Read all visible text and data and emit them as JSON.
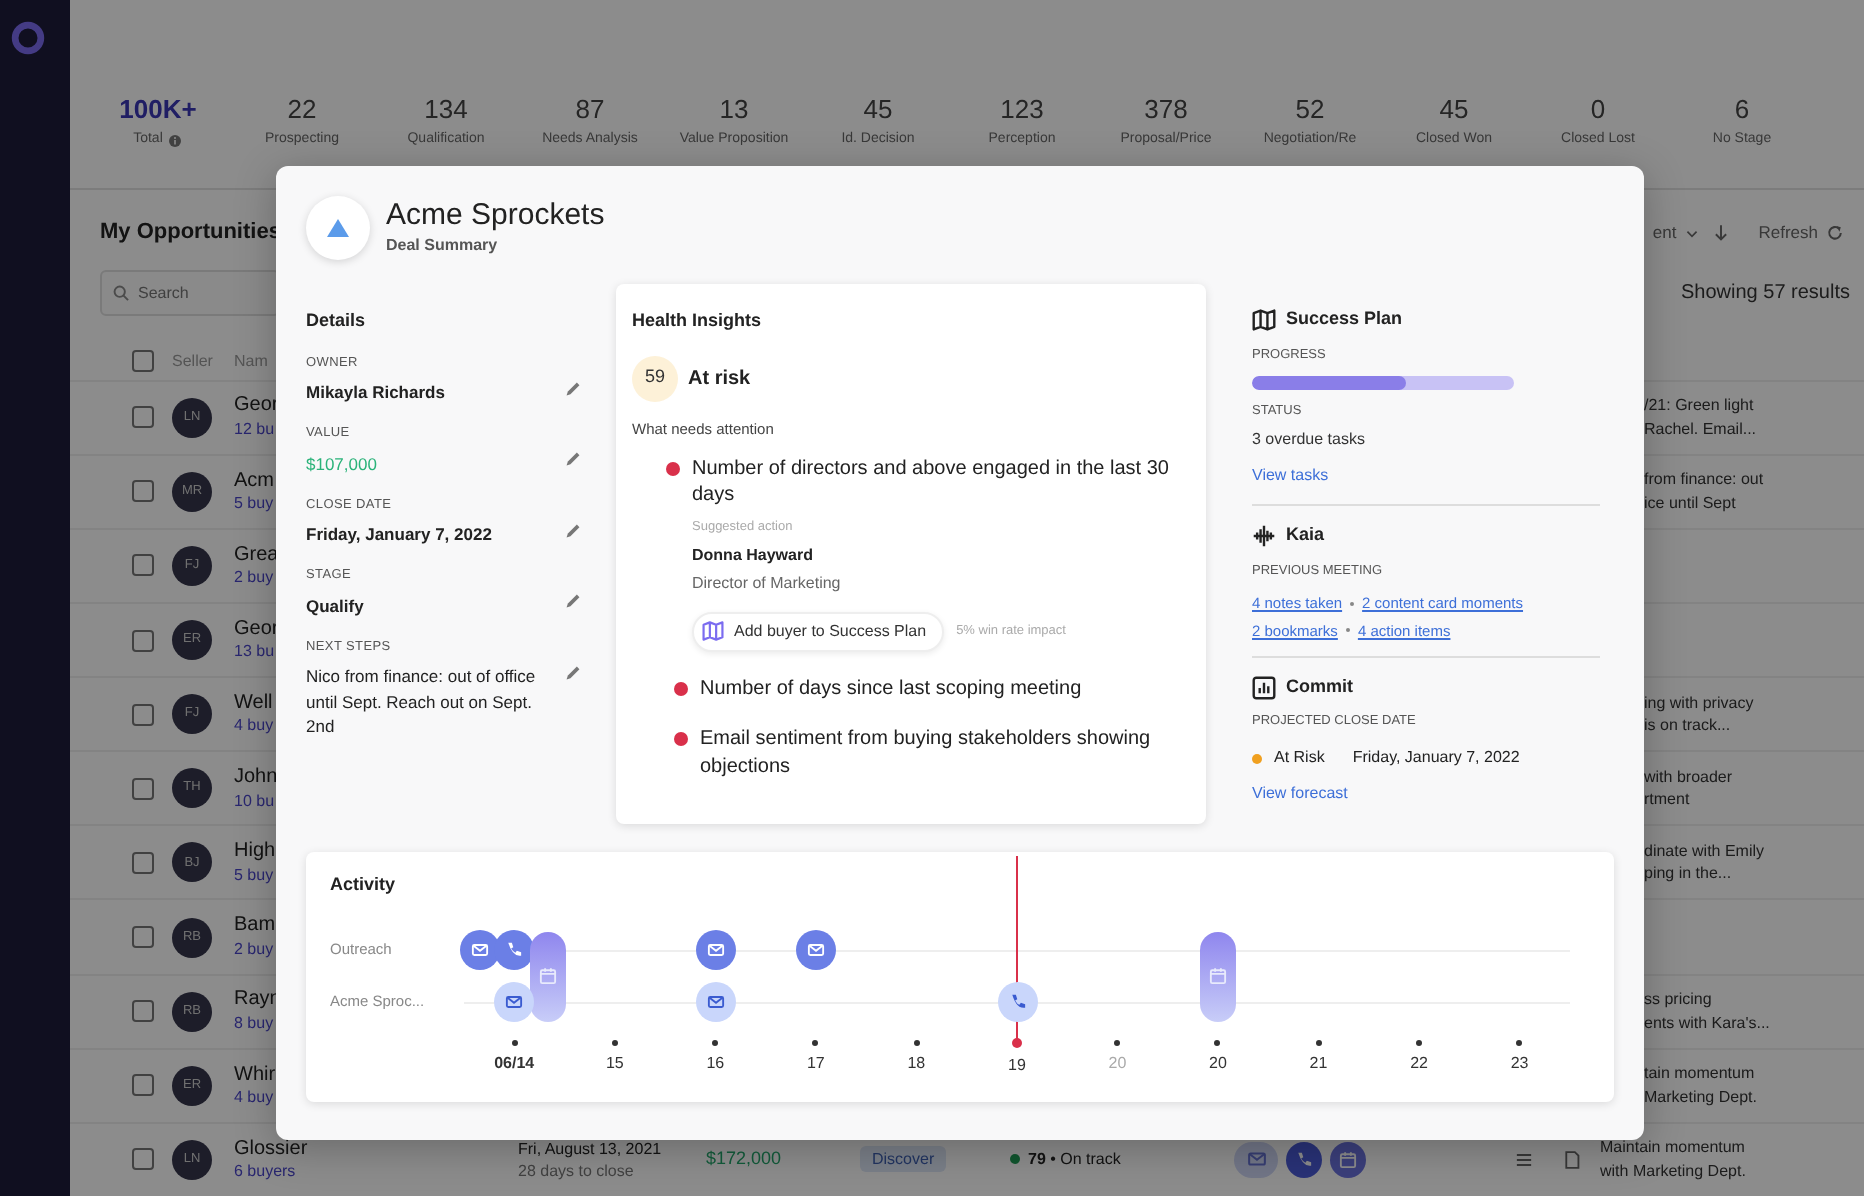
{
  "stats": [
    {
      "kind": "total",
      "value": "100K+",
      "label": "Total"
    },
    {
      "kind": "stage",
      "value": "22",
      "label": "Prospecting"
    },
    {
      "kind": "stage",
      "value": "134",
      "label": "Qualification"
    },
    {
      "kind": "stage",
      "value": "87",
      "label": "Needs Analysis"
    },
    {
      "kind": "stage",
      "value": "13",
      "label": "Value Proposition"
    },
    {
      "kind": "stage",
      "value": "45",
      "label": "Id. Decision"
    },
    {
      "kind": "stage",
      "value": "123",
      "label": "Perception"
    },
    {
      "kind": "stage",
      "value": "378",
      "label": "Proposal/Price"
    },
    {
      "kind": "stage",
      "value": "52",
      "label": "Negotiation/Re"
    },
    {
      "kind": "stage",
      "value": "45",
      "label": "Closed Won"
    },
    {
      "kind": "stage",
      "value": "0",
      "label": "Closed Lost"
    },
    {
      "kind": "stage",
      "value": "6",
      "label": "No Stage"
    }
  ],
  "list": {
    "title": "My Opportunities",
    "sort": "ent",
    "refresh": "Refresh",
    "search": {
      "placeholder": "Search"
    },
    "results": "Showing 57 results",
    "header_checked": false,
    "columns": [
      "Seller",
      "Nam"
    ],
    "rows": [
      {
        "kind": "partial",
        "checked": false,
        "initials": "LN",
        "name": "Geor",
        "buyers": "12 bu",
        "note": [
          "/21: Green light",
          "Rachel. Email..."
        ]
      },
      {
        "kind": "partial",
        "checked": false,
        "initials": "MR",
        "name": "Acm",
        "buyers": "5 buy",
        "note": [
          "from finance: out",
          "ice until Sept"
        ]
      },
      {
        "kind": "partial",
        "checked": false,
        "initials": "FJ",
        "name": "Grea",
        "buyers": "2 buy"
      },
      {
        "kind": "partial",
        "checked": false,
        "initials": "ER",
        "name": "Geor",
        "buyers": "13 bu"
      },
      {
        "kind": "partial",
        "checked": false,
        "initials": "FJ",
        "name": "Well",
        "buyers": "4 buy",
        "note": [
          "ing with privacy",
          "is on track..."
        ]
      },
      {
        "kind": "partial",
        "checked": false,
        "initials": "TH",
        "name": "John",
        "buyers": "10 bu",
        "note": [
          "with broader",
          "rtment"
        ]
      },
      {
        "kind": "partial",
        "checked": false,
        "initials": "BJ",
        "name": "High",
        "buyers": "5 buy",
        "note": [
          "dinate with Emily",
          "ping in the..."
        ]
      },
      {
        "kind": "partial",
        "checked": false,
        "initials": "RB",
        "name": "Bam",
        "buyers": "2 buy"
      },
      {
        "kind": "partial",
        "checked": false,
        "initials": "RB",
        "name": "Rayn",
        "buyers": "8 buy",
        "note": [
          "ss pricing",
          "ents with Kara's..."
        ]
      },
      {
        "kind": "partial",
        "checked": false,
        "initials": "ER",
        "name": "Whir",
        "buyers": "4 buy",
        "note": [
          "tain momentum",
          "Marketing Dept."
        ]
      },
      {
        "kind": "full",
        "checked": false,
        "initials": "LN",
        "name": "Glossier",
        "buyers": "6 buyers",
        "close_date": "Fri, August 13, 2021",
        "days_to_close": "28 days to close",
        "value": "$172,000",
        "stage": "Discover",
        "on_track": true,
        "health": "**79** • On track",
        "note": [
          "Maintain momentum",
          "with Marketing Dept."
        ]
      }
    ]
  },
  "deal": {
    "title": "Acme Sprockets",
    "subtitle": "Deal Summary",
    "details": {
      "title": "Details",
      "fields": [
        {
          "kind": "text",
          "label": "OWNER",
          "value": "Mikayla Richards"
        },
        {
          "kind": "money",
          "label": "VALUE",
          "value": "$107,000"
        },
        {
          "kind": "text",
          "label": "CLOSE DATE",
          "value": "Friday, January 7, 2022"
        },
        {
          "kind": "text",
          "label": "STAGE",
          "value": "Qualify"
        },
        {
          "kind": "note",
          "label": "NEXT STEPS",
          "value": "Nico from finance: out of office until Sept. Reach out on Sept. 2nd"
        }
      ]
    },
    "health": {
      "title": "Health Insights",
      "score": "59",
      "status": "At risk",
      "subtitle": "What needs attention",
      "items": [
        {
          "text": "Number of directors and above engaged in the last 30 days",
          "suggestion": {
            "label": "Suggested action",
            "name": "Donna Hayward",
            "role": "Director of Marketing",
            "button": "Add buyer to Success Plan",
            "impact": "5% win rate impact"
          }
        },
        {
          "text": "Number of days since last scoping meeting"
        },
        {
          "text": "Email sentiment from buying stakeholders showing objections"
        }
      ]
    },
    "success_plan": {
      "title": "Success Plan",
      "progress_label": "PROGRESS",
      "level": 0.59,
      "status_label": "STATUS",
      "status": "3 overdue tasks",
      "link": "View tasks"
    },
    "kaia": {
      "title": "Kaia",
      "label": "PREVIOUS MEETING",
      "link_rows": [
        [
          "4 notes taken",
          "2 content card moments"
        ],
        [
          "2 bookmarks",
          "4 action items"
        ]
      ]
    },
    "commit": {
      "title": "Commit",
      "label": "PROJECTED CLOSE DATE",
      "status": "At Risk",
      "color": "#f0a020",
      "date": "Friday, January 7, 2022",
      "link": "View forecast"
    },
    "activity": {
      "title": "Activity",
      "lanes": [
        {
          "kind": "team",
          "label": "Outreach"
        },
        {
          "kind": "account",
          "label": "Acme Sproc..."
        }
      ],
      "days": [
        {
          "label": "06/14",
          "bold": true,
          "muted": false,
          "today": false,
          "events": [
            {
              "account_lane": false,
              "kind": "email"
            },
            {
              "account_lane": false,
              "kind": "phone"
            },
            {
              "account_lane": false,
              "kind": "meeting"
            },
            {
              "account_lane": true,
              "kind": "email"
            }
          ]
        },
        {
          "label": "15",
          "bold": false,
          "muted": false,
          "today": false
        },
        {
          "label": "16",
          "bold": false,
          "muted": false,
          "today": false,
          "events": [
            {
              "account_lane": false,
              "kind": "email"
            },
            {
              "account_lane": true,
              "kind": "email"
            }
          ]
        },
        {
          "label": "17",
          "bold": false,
          "muted": false,
          "today": false,
          "events": [
            {
              "account_lane": false,
              "kind": "email"
            }
          ]
        },
        {
          "label": "18",
          "bold": false,
          "muted": false,
          "today": false
        },
        {
          "label": "19",
          "bold": false,
          "muted": false,
          "today": true,
          "events": [
            {
              "account_lane": true,
              "kind": "phone"
            }
          ]
        },
        {
          "label": "20",
          "bold": false,
          "muted": true,
          "today": false
        },
        {
          "label": "20",
          "bold": false,
          "muted": false,
          "today": false,
          "events": [
            {
              "account_lane": false,
              "kind": "meeting"
            }
          ]
        },
        {
          "label": "21",
          "bold": false,
          "muted": false,
          "today": false
        },
        {
          "label": "22",
          "bold": false,
          "muted": false,
          "today": false
        },
        {
          "label": "23",
          "bold": false,
          "muted": false,
          "today": false
        }
      ]
    }
  }
}
